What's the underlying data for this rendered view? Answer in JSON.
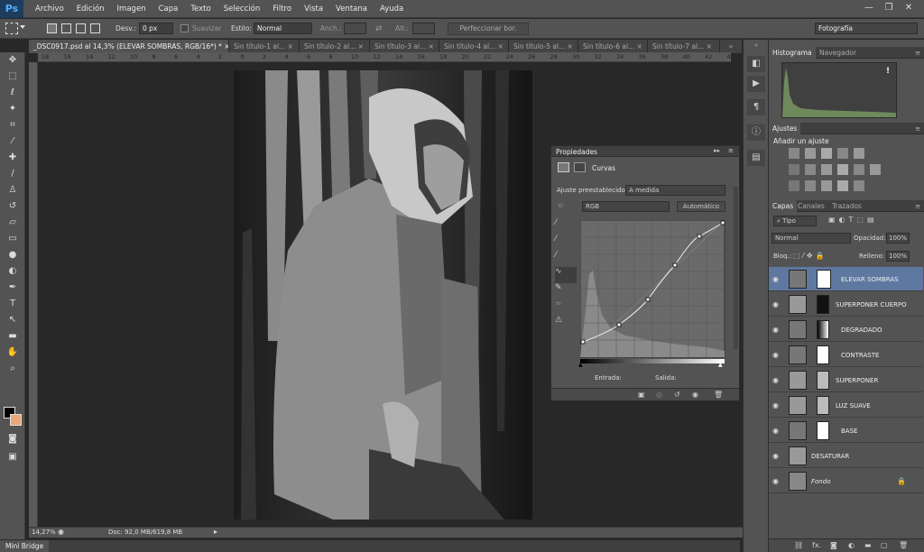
{
  "app": {
    "logo": "Ps"
  },
  "menu": [
    "Archivo",
    "Edición",
    "Imagen",
    "Capa",
    "Texto",
    "Selección",
    "Filtro",
    "Vista",
    "Ventana",
    "Ayuda"
  ],
  "window_buttons": [
    "—",
    "❐",
    "✕"
  ],
  "options": {
    "desv_label": "Desv.:",
    "desv_value": "0 px",
    "suavizar": "Suavizar",
    "estilo_label": "Estilo:",
    "estilo_value": "Normal",
    "anch_label": "Anch.:",
    "alt_label": "Alt.:",
    "refine_button": "Perfeccionar bor.",
    "workspace": "Fotografía"
  },
  "tabs": [
    {
      "label": "_DSC0917.psd al 14,3% (ELEVAR SOMBRAS, RGB/16*) *",
      "close": "×"
    },
    {
      "label": "Sin título-1 al...",
      "close": "×"
    },
    {
      "label": "Sin título-2 al...",
      "close": "×"
    },
    {
      "label": "Sin título-3 al...",
      "close": "×"
    },
    {
      "label": "Sin título-4 al...",
      "close": "×"
    },
    {
      "label": "Sin título-5 al...",
      "close": "×"
    },
    {
      "label": "Sin título-6 al...",
      "close": "×"
    },
    {
      "label": "Sin título-7 al...",
      "close": "×"
    }
  ],
  "tab_more": "»",
  "ruler": {
    "top": [
      "18",
      "16",
      "14",
      "12",
      "10",
      "8",
      "6",
      "4",
      "2",
      "0",
      "2",
      "4",
      "6",
      "8",
      "10",
      "12",
      "14",
      "16",
      "18",
      "20",
      "22",
      "24",
      "26",
      "28",
      "30",
      "32",
      "34",
      "36",
      "38",
      "40",
      "42",
      "44"
    ]
  },
  "status": {
    "zoom": "14,27%",
    "doc": "Doc: 92,0 MB/619,8 MB"
  },
  "minibridge": "Mini Bridge",
  "histogram": {
    "tab_active": "Histograma",
    "tab_other": "Navegador",
    "warning": "!"
  },
  "adjustments": {
    "tab": "Ajustes",
    "title": "Añadir un ajuste"
  },
  "layers_panel": {
    "tabs": [
      "Capas",
      "Canales",
      "Trazados"
    ],
    "filter_value": "Tipo",
    "blend_mode": "Normal",
    "opacity_label": "Opacidad:",
    "opacity_value": "100%",
    "lock_label": "Bloq.:",
    "fill_label": "Relleno:",
    "fill_value": "100%",
    "layers": [
      {
        "name": "ELEVAR SOMBRAS",
        "selected": true
      },
      {
        "name": "SUPERPONER CUERPO"
      },
      {
        "name": "DEGRADADO"
      },
      {
        "name": "CONTRASTE"
      },
      {
        "name": "SUPERPONER"
      },
      {
        "name": "LUZ SUAVE"
      },
      {
        "name": "BASE"
      },
      {
        "name": "DESATURAR"
      },
      {
        "name": "Fondo"
      }
    ],
    "footer_fx": "fx."
  },
  "properties": {
    "title": "Propiedades",
    "panel_name": "Curvas",
    "preset_label": "Ajuste preestablecido:",
    "preset_value": "A medida",
    "channel_value": "RGB",
    "auto_button": "Automático",
    "input_label": "Entrada:",
    "output_label": "Salida:"
  }
}
